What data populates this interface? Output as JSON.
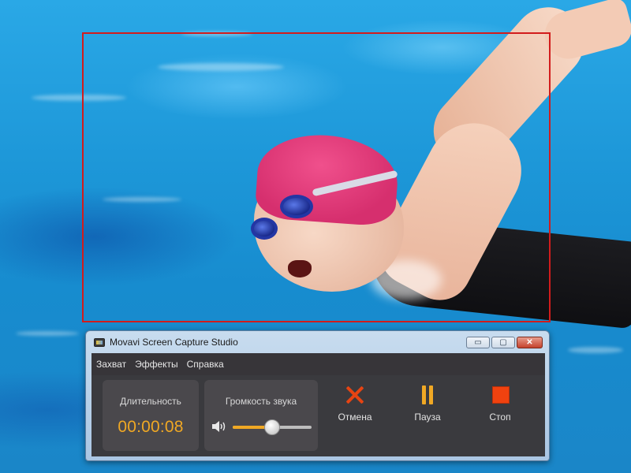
{
  "window": {
    "title": "Movavi Screen Capture Studio",
    "controls": {
      "minimize": "▭",
      "maximize": "▢",
      "close": "✕"
    }
  },
  "menu": {
    "items": [
      "Захват",
      "Эффекты",
      "Справка"
    ]
  },
  "duration": {
    "label": "Длительность",
    "value": "00:00:08"
  },
  "volume": {
    "label": "Громкость звука",
    "level": 0.5,
    "icon": "speaker-icon"
  },
  "actions": {
    "cancel": {
      "label": "Отмена",
      "icon": "x-icon"
    },
    "pause": {
      "label": "Пауза",
      "icon": "pause-icon"
    },
    "stop": {
      "label": "Стоп",
      "icon": "stop-icon"
    }
  },
  "colors": {
    "accent": "#f0a824",
    "capture_frame": "#d21c1c",
    "cancel": "#e74412",
    "stop": "#f0420f"
  }
}
